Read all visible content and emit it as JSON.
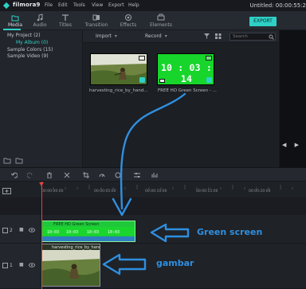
{
  "app": {
    "logo_text": "filmora9",
    "menu": [
      "File",
      "Edit",
      "Tools",
      "View",
      "Export",
      "Help"
    ],
    "doc_title": "Untitled: 00:00:55:2",
    "accent": "#2fd0c6"
  },
  "tabs": [
    {
      "label": "Media",
      "icon": "folder-icon",
      "active": true
    },
    {
      "label": "Audio",
      "icon": "music-note-icon"
    },
    {
      "label": "Titles",
      "icon": "text-icon"
    },
    {
      "label": "Transition",
      "icon": "transition-icon"
    },
    {
      "label": "Effects",
      "icon": "effects-icon"
    },
    {
      "label": "Elements",
      "icon": "elements-icon"
    }
  ],
  "export_label": "EXPORT",
  "library": {
    "items": [
      {
        "label": "My Project (2)"
      },
      {
        "label": "My Album (0)"
      },
      {
        "label": "Sample Colors (15)"
      },
      {
        "label": "Sample Video (9)"
      }
    ]
  },
  "media_toolbar": {
    "import_label": "Import",
    "record_label": "Record",
    "search_placeholder": "Search"
  },
  "media_items": [
    {
      "label": "harvesting_rice_by_hand...",
      "kind": "photo"
    },
    {
      "label": "FREE HD Green Screen - ...",
      "kind": "green-screen",
      "timecode": "10 : 03 : 14"
    }
  ],
  "timeline": {
    "timecodes": [
      "00:00:00:00",
      "00:00:05:00",
      "00:00:10:00",
      "00:00:15:00",
      "00:00:20:00"
    ],
    "tracks": [
      {
        "number": "2",
        "clip_title": "FREE HD Green Screen"
      },
      {
        "number": "1",
        "clip_title": "harvesting_rice_by_hand"
      }
    ]
  },
  "annotations": {
    "green_screen_label": "Green screen",
    "image_label": "gambar",
    "color": "#2f8fe0"
  }
}
